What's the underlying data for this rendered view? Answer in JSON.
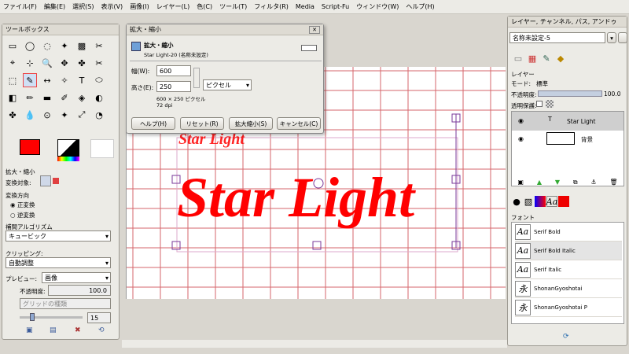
{
  "menu": [
    "ファイル(F)",
    "編集(E)",
    "選択(S)",
    "表示(V)",
    "画像(I)",
    "レイヤー(L)",
    "色(C)",
    "ツール(T)",
    "フィルタ(R)",
    "Media",
    "Script-Fu",
    "ウィンドウ(W)",
    "ヘルプ(H)"
  ],
  "toolbox": {
    "title": "ツールボックス",
    "options_title": "拡大・縮小",
    "transform_target": "変換対象:",
    "transform_direction": "変換方向",
    "dir_normal": "正変換",
    "dir_reverse": "逆変換",
    "interp_label": "補間アルゴリズム",
    "interp_value": "キュービック",
    "clipping_label": "クリッピング:",
    "clipping_value": "自動調整",
    "preview_label": "プレビュー:",
    "preview_value": "画像",
    "opacity_label": "不透明度:",
    "opacity_value": "100.0",
    "grid_label": "グリッドの種類",
    "grid_value": "15",
    "fg_color": "#ff0000",
    "bg_color": "#000000"
  },
  "dialog": {
    "title": "拡大・縮小",
    "heading": "拡大・縮小",
    "subtitle": "Star Light-20 (名称未設定)",
    "width_label": "幅(W):",
    "width_value": "600",
    "height_label": "高さ(E):",
    "height_value": "250",
    "unit": "ピクセル",
    "size_info": "600 × 250 ピクセル",
    "dpi": "72 dpi",
    "btn_help": "ヘルプ(H)",
    "btn_reset": "リセット(R)",
    "btn_scale": "拡大縮小(S)",
    "btn_cancel": "キャンセル(C)"
  },
  "canvas": {
    "text": "Star Light",
    "small_text": "Star Light",
    "text_color": "#ff0000"
  },
  "dock": {
    "title": "レイヤー, チャンネル, パス, アンドゥ",
    "image_select": "名称未設定-5",
    "layers_label": "レイヤー",
    "mode_label": "モード:",
    "mode_value": "標準",
    "opacity_label": "不透明度:",
    "opacity_value": "100.0",
    "lock_label": "透明保護:",
    "layers": [
      {
        "name": "Star Light"
      },
      {
        "name": "背景"
      }
    ],
    "fonts_label": "フォント",
    "fonts": [
      "Serif Bold",
      "Serif Bold Italic",
      "Serif Italic",
      "ShonanGyoshotai",
      "ShonanGyoshotai P"
    ]
  }
}
